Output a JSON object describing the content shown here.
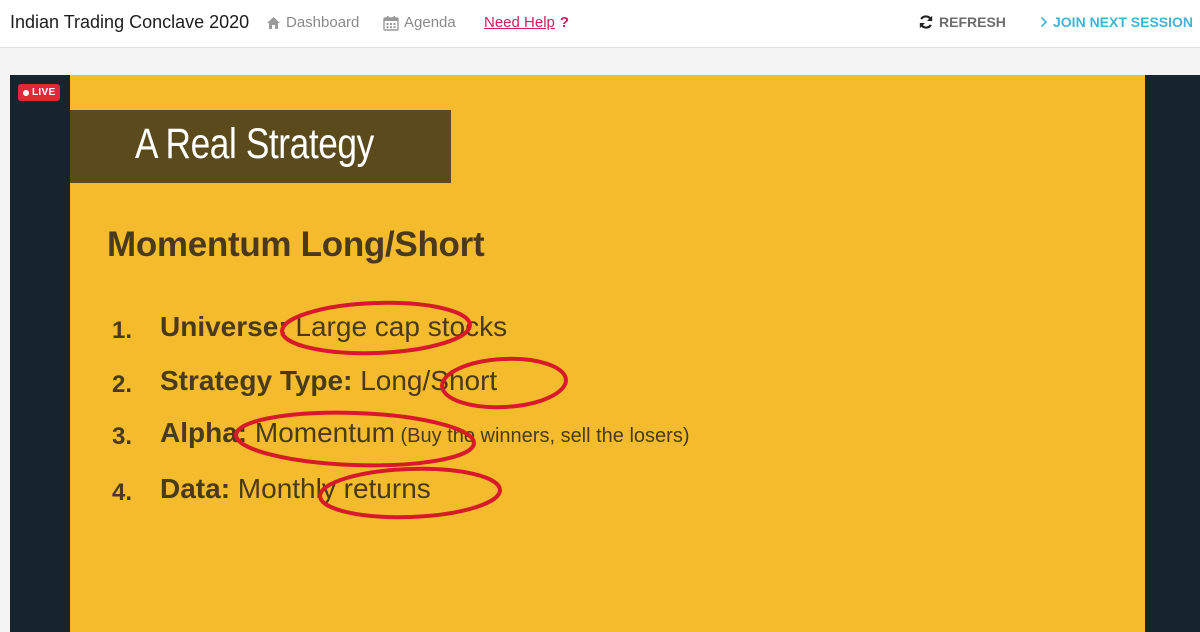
{
  "header": {
    "brand": "Indian Trading Conclave 2020",
    "dashboard_label": "Dashboard",
    "agenda_label": "Agenda",
    "help_label": "Need Help",
    "help_mark": "?",
    "refresh_label": "REFRESH",
    "join_label": "JOIN NEXT SESSION"
  },
  "stream": {
    "live_label": "LIVE"
  },
  "slide": {
    "title": "A Real Strategy",
    "subtitle": "Momentum Long/Short",
    "items": [
      {
        "number": "1.",
        "label": "Universe:",
        "value": " Large cap stocks",
        "note": ""
      },
      {
        "number": "2.",
        "label": "Strategy Type:",
        "value": " Long/Short",
        "note": ""
      },
      {
        "number": "3.",
        "label": "Alpha:",
        "value": " Momentum",
        "note": " (Buy the winners, sell the losers)"
      },
      {
        "number": "4.",
        "label": "Data:",
        "value": " Monthly returns",
        "note": ""
      }
    ]
  },
  "colors": {
    "slide_bg": "#f4bc2c",
    "title_band": "#5b4a1b",
    "text": "#4a3a1a",
    "annotation": "#d8192a",
    "live": "#e0283a",
    "help": "#d81b60",
    "join": "#3fb6d6",
    "stage_bg": "#17242d"
  }
}
